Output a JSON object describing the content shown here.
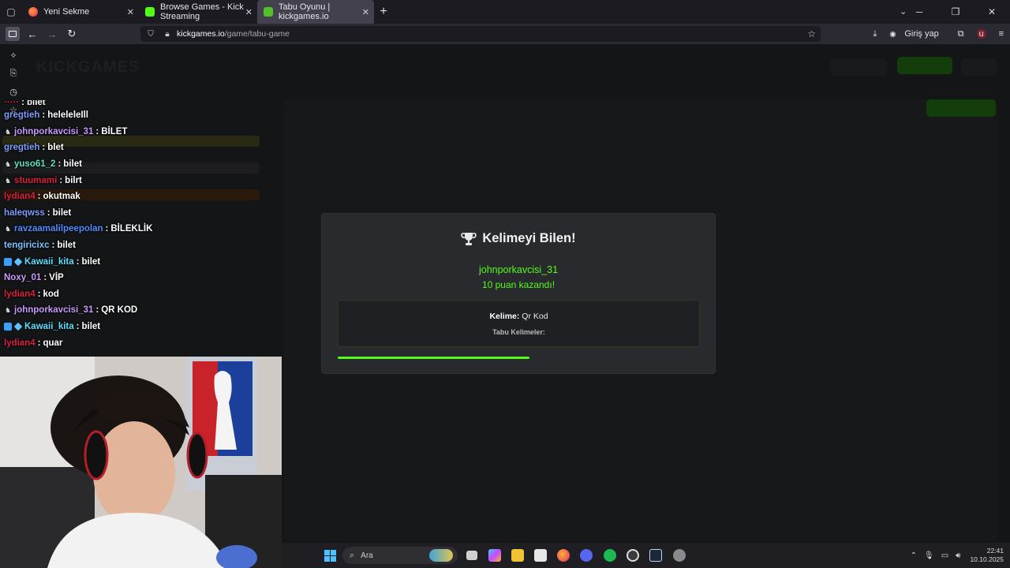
{
  "browser": {
    "tabs": [
      {
        "label": "Yeni Sekme",
        "active": false
      },
      {
        "label": "Browse Games - Kick Streaming",
        "active": false
      },
      {
        "label": "Tabu Oyunu | kickgames.io",
        "active": true
      }
    ],
    "url_domain": "kickgames.io",
    "url_path": "/game/tabu-game",
    "signin_label": "Giriş yap"
  },
  "chat": {
    "partial_text": "bilet",
    "messages": [
      {
        "user": "gregtieh",
        "color": "#7d9cff",
        "badges": [],
        "text": "heleleleIll"
      },
      {
        "user": "johnporkavcisi_31",
        "color": "#c99bff",
        "badges": [
          "bell"
        ],
        "text": "BİLET"
      },
      {
        "user": "gregtieh",
        "color": "#7d9cff",
        "badges": [],
        "text": "blet"
      },
      {
        "user": "yuso61_2",
        "color": "#5de0c0",
        "badges": [
          "bell"
        ],
        "text": "bilet"
      },
      {
        "user": "stuumami",
        "color": "#d9213f",
        "badges": [
          "bell"
        ],
        "text": "bilrt"
      },
      {
        "user": "lydian4",
        "color": "#d9213f",
        "badges": [],
        "text": "okutmak"
      },
      {
        "user": "haleqwss",
        "color": "#7d9cff",
        "badges": [],
        "text": "bilet"
      },
      {
        "user": "ravzaamalilpeepolan",
        "color": "#4f8dff",
        "badges": [
          "bell"
        ],
        "text": "BİLEKLİK"
      },
      {
        "user": "tengiricixc",
        "color": "#7ec3ff",
        "badges": [],
        "text": "bilet"
      },
      {
        "user": "Kawaii_kita",
        "color": "#5de0ff",
        "badges": [
          "sq",
          "gem"
        ],
        "text": "bilet"
      },
      {
        "user": "Noxy_01",
        "color": "#c99bff",
        "badges": [],
        "text": "VİP"
      },
      {
        "user": "lydian4",
        "color": "#d9213f",
        "badges": [],
        "text": "kod"
      },
      {
        "user": "johnporkavcisi_31",
        "color": "#c99bff",
        "badges": [
          "bell"
        ],
        "text": "QR KOD"
      },
      {
        "user": "Kawaii_kita",
        "color": "#5de0ff",
        "badges": [
          "sq",
          "gem"
        ],
        "text": "bilet"
      },
      {
        "user": "lydian4",
        "color": "#d9213f",
        "badges": [],
        "text": "quar"
      }
    ]
  },
  "modal": {
    "title": "Kelimeyi Bilen!",
    "winner": "johnporkavcisi_31",
    "points_text": "10 puan kazandı!",
    "word_label": "Kelime:",
    "word_value": "Qr Kod",
    "taboo_label": "Tabu Kelimeler:",
    "progress": 0.53,
    "accent": "#53fc18"
  },
  "taskbar": {
    "search_placeholder": "Ara",
    "time": "22:41",
    "date": "10.10.2025"
  }
}
